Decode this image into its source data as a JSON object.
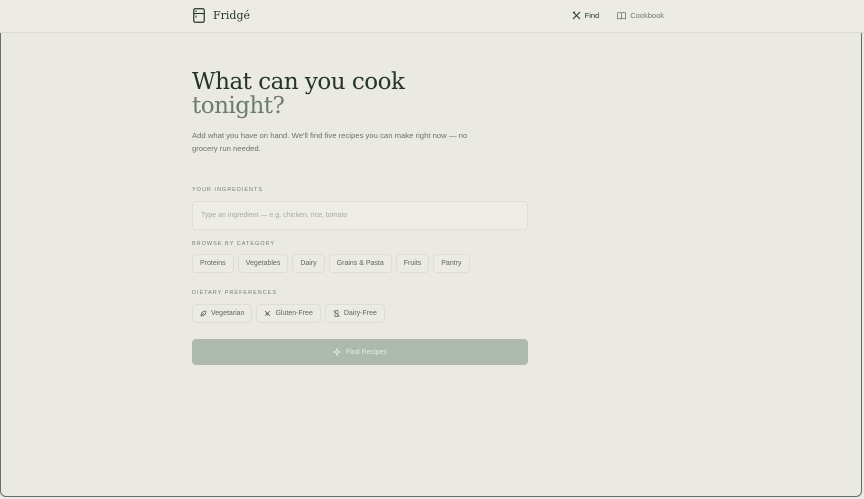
{
  "brand": {
    "name": "Fridgé"
  },
  "nav": {
    "find": "Find",
    "cookbook": "Cookbook"
  },
  "hero": {
    "line1": "What can you cook",
    "line2": "tonight?",
    "intro": "Add what you have on hand. We'll find five recipes you can make right now — no grocery run needed."
  },
  "ingredients": {
    "label": "YOUR INGREDIENTS",
    "placeholder": "Type an ingredient — e.g. chicken, rice, tomato"
  },
  "categories": {
    "label": "BROWSE BY CATEGORY",
    "items": [
      "Proteins",
      "Vegetables",
      "Dairy",
      "Grains & Pasta",
      "Fruits",
      "Pantry"
    ]
  },
  "dietary": {
    "label": "DIETARY PREFERENCES",
    "items": [
      "Vegetarian",
      "Gluten-Free",
      "Dairy-Free"
    ]
  },
  "action": {
    "find_label": "Find Recipes"
  }
}
